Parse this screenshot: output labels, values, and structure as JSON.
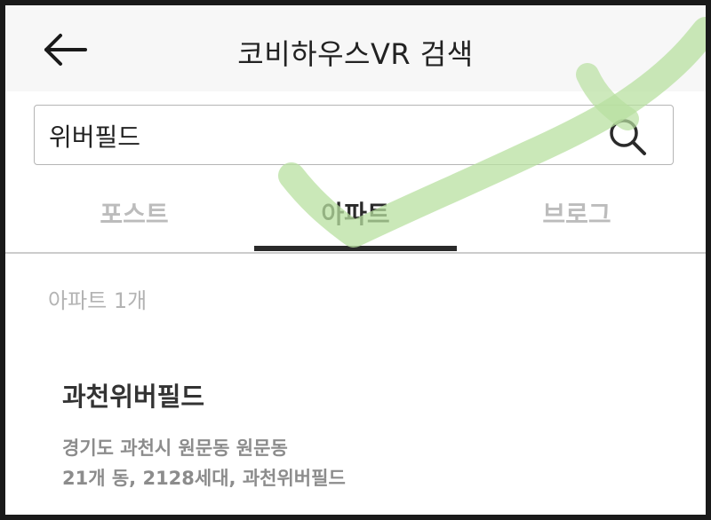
{
  "header": {
    "title": "코비하우스VR 검색"
  },
  "search": {
    "value": "위버필드"
  },
  "tabs": [
    {
      "label": "포스트",
      "active": false
    },
    {
      "label": "아파트",
      "active": true
    },
    {
      "label": "브로그",
      "active": false
    }
  ],
  "results": {
    "count_label": "아파트 1개",
    "items": [
      {
        "name": "과천위버필드",
        "address": "경기도 과천시 원문동  원문동",
        "details": "21개 동, 2128세대, 과천위버필드"
      }
    ]
  },
  "colors": {
    "header_bg": "#f7f7f7",
    "active_tab": "#2a2a2a",
    "inactive_tab": "#bcbcbc",
    "check_overlay": "#b8e0a0"
  },
  "icons": {
    "back": "arrow-left-icon",
    "search": "magnifier-icon",
    "overlay": "checkmark-icon"
  }
}
